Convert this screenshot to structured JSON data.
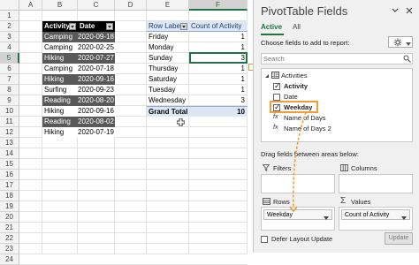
{
  "sheet": {
    "columns": [
      "A",
      "B",
      "C",
      "D",
      "E",
      "F"
    ],
    "selected_column": "F",
    "rows": [
      "1",
      "2",
      "3",
      "4",
      "5",
      "6",
      "7",
      "8",
      "9",
      "10",
      "11",
      "12",
      "13",
      "14",
      "15",
      "16",
      "17",
      "18",
      "19",
      "20",
      "21",
      "22",
      "23",
      "24"
    ],
    "selected_row": "5"
  },
  "source_table": {
    "headers": [
      "Activity",
      "Date"
    ],
    "rows": [
      {
        "activity": "Camping",
        "date": "2020-09-18",
        "style": "dark"
      },
      {
        "activity": "Camping",
        "date": "2020-02-25",
        "style": "light"
      },
      {
        "activity": "Hiking",
        "date": "2020-07-27",
        "style": "dark"
      },
      {
        "activity": "Camping",
        "date": "2020-07-18",
        "style": "light"
      },
      {
        "activity": "Hiking",
        "date": "2020-09-16",
        "style": "dark"
      },
      {
        "activity": "Surfing",
        "date": "2020-09-23",
        "style": "light"
      },
      {
        "activity": "Reading",
        "date": "2020-08-20",
        "style": "dark"
      },
      {
        "activity": "Hiking",
        "date": "2020-09-16",
        "style": "light"
      },
      {
        "activity": "Reading",
        "date": "2020-08-02",
        "style": "dark"
      },
      {
        "activity": "Hiking",
        "date": "2020-07-19",
        "style": "light"
      }
    ]
  },
  "pivot_table": {
    "row_labels_header": "Row Labels",
    "value_header": "Count of Activity",
    "rows": [
      {
        "label": "Friday",
        "count": "1"
      },
      {
        "label": "Monday",
        "count": "1"
      },
      {
        "label": "Sunday",
        "count": "3"
      },
      {
        "label": "Thursday",
        "count": "1"
      },
      {
        "label": "Saturday",
        "count": "1"
      },
      {
        "label": "Tuesday",
        "count": "1"
      },
      {
        "label": "Wednesday",
        "count": "3"
      }
    ],
    "total_label": "Grand Total",
    "total_value": "10"
  },
  "pane": {
    "title": "PivotTable Fields",
    "tab_active": "Active",
    "tab_all": "All",
    "choose_label": "Choose fields to add to report:",
    "search_placeholder": "Search",
    "table_name": "Activities",
    "fields": [
      {
        "name": "Activity",
        "checked": true
      },
      {
        "name": "Date",
        "checked": false
      },
      {
        "name": "Weekday",
        "checked": true
      },
      {
        "name": "Name of Days",
        "checked": false,
        "calc": true
      },
      {
        "name": "Name of Days 2",
        "checked": false,
        "calc": true
      }
    ],
    "drag_label": "Drag fields between areas below:",
    "filters_label": "Filters",
    "columns_label": "Columns",
    "rows_label": "Rows",
    "values_label": "Values",
    "rows_chip": "Weekday",
    "values_chip": "Count of Activity",
    "defer_label": "Defer Layout Update",
    "update_button": "Update"
  },
  "colors": {
    "accent": "#217346",
    "highlight": "#f29d38"
  }
}
